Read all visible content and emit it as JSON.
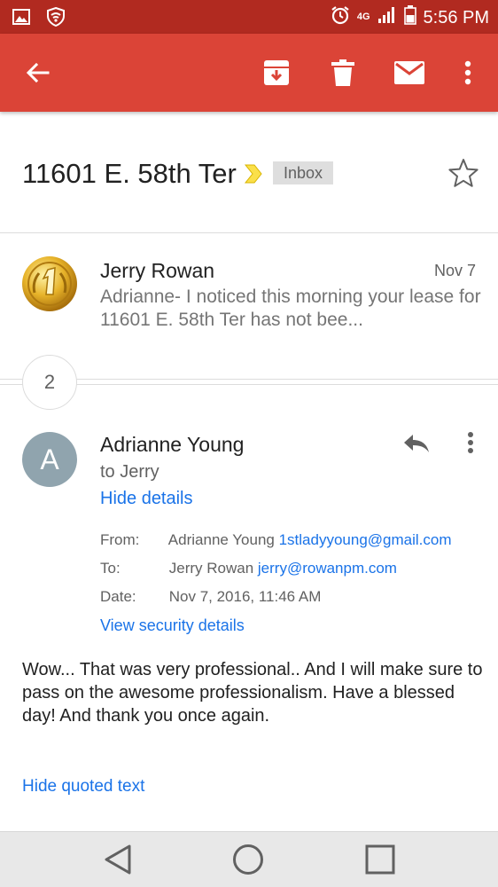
{
  "status_bar": {
    "network_label": "4G",
    "time": "5:56 PM"
  },
  "app_bar": {
    "icons": [
      "back-arrow-icon",
      "archive-icon",
      "delete-icon",
      "mark-unread-icon",
      "more-vert-icon"
    ]
  },
  "thread": {
    "subject": "11601 E. 58th Ter",
    "label": "Inbox",
    "starred": false,
    "collapsed_count": "2"
  },
  "messages": [
    {
      "sender": "Jerry Rowan",
      "date": "Nov 7",
      "snippet": "Adrianne- I noticed this morning your lease for 11601 E. 58th Ter has not bee..."
    },
    {
      "avatar_letter": "A",
      "sender": "Adrianne Young",
      "to_line": "to Jerry",
      "hide_details": "Hide details",
      "details": {
        "from_label": "From:",
        "from_name": "Adrianne Young",
        "from_email": "1stladyyoung@gmail.com",
        "to_label": "To:",
        "to_name": "Jerry Rowan",
        "to_email": "jerry@rowanpm.com",
        "date_label": "Date:",
        "date_value": "Nov 7, 2016, 11:46 AM"
      },
      "security_link": "View security details",
      "body": "Wow... That was very professional.. And I will make sure to pass on the awesome professionalism. Have a blessed day! And thank you once again.",
      "quoted_link": "Hide quoted text"
    }
  ],
  "colors": {
    "app_bar": "#db4437",
    "status_bar": "#b12a20",
    "link": "#1a73e8",
    "avatar": "#90a4ae"
  }
}
